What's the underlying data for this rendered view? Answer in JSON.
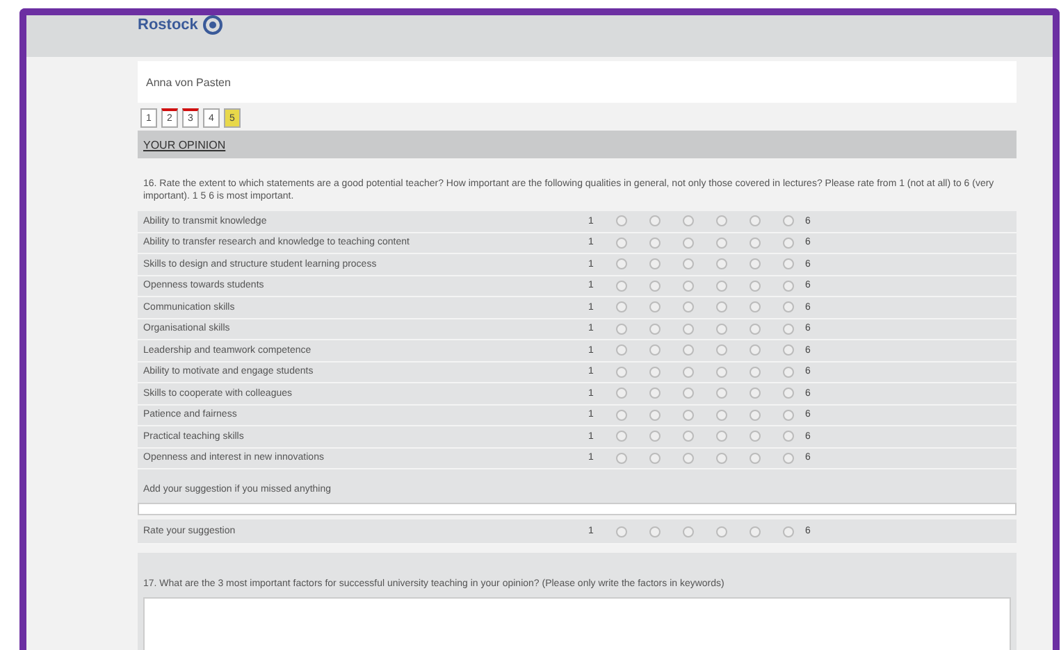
{
  "header": {
    "logo_text": "Rostock"
  },
  "respondent": {
    "name": "Anna von Pasten"
  },
  "pages": [
    {
      "label": "1",
      "selected": false,
      "completed": false
    },
    {
      "label": "2",
      "selected": false,
      "completed": true
    },
    {
      "label": "3",
      "selected": false,
      "completed": true
    },
    {
      "label": "4",
      "selected": false,
      "completed": false
    },
    {
      "label": "5",
      "selected": true,
      "completed": false
    }
  ],
  "section": {
    "title": "YOUR OPINION"
  },
  "question_16": {
    "text": "16. Rate the extent to which statements are a good potential teacher? How important are the following qualities in general, not only those covered in lectures? Please rate from 1 (not at all) to 6 (very important). 1 5 6 is most important.",
    "items": [
      {
        "label": "Ability to transmit knowledge",
        "scale_low": "1",
        "scale_high": "6",
        "choices": [
          false,
          false,
          false,
          false,
          false,
          false
        ]
      },
      {
        "label": "Ability to transfer research and knowledge to teaching content",
        "scale_low": "1",
        "scale_high": "6",
        "choices": [
          false,
          false,
          false,
          false,
          false,
          false
        ]
      },
      {
        "label": "Skills to design and structure student learning process",
        "scale_low": "1",
        "scale_high": "6",
        "choices": [
          false,
          false,
          false,
          false,
          false,
          false
        ]
      },
      {
        "label": "Openness towards students",
        "scale_low": "1",
        "scale_high": "6",
        "choices": [
          false,
          false,
          false,
          false,
          false,
          false
        ]
      },
      {
        "label": "Communication skills",
        "scale_low": "1",
        "scale_high": "6",
        "choices": [
          false,
          false,
          false,
          false,
          false,
          false
        ]
      },
      {
        "label": "Organisational skills",
        "scale_low": "1",
        "scale_high": "6",
        "choices": [
          false,
          false,
          false,
          false,
          false,
          false
        ]
      },
      {
        "label": "Leadership and teamwork competence",
        "scale_low": "1",
        "scale_high": "6",
        "choices": [
          false,
          false,
          false,
          false,
          false,
          false
        ]
      },
      {
        "label": "Ability to motivate and engage students",
        "scale_low": "1",
        "scale_high": "6",
        "choices": [
          false,
          false,
          false,
          false,
          false,
          false
        ]
      },
      {
        "label": "Skills to cooperate with colleagues",
        "scale_low": "1",
        "scale_high": "6",
        "choices": [
          false,
          false,
          false,
          false,
          false,
          false
        ]
      },
      {
        "label": "Patience and fairness",
        "scale_low": "1",
        "scale_high": "6",
        "choices": [
          false,
          false,
          false,
          false,
          false,
          false
        ]
      },
      {
        "label": "Practical teaching skills",
        "scale_low": "1",
        "scale_high": "6",
        "choices": [
          false,
          false,
          false,
          false,
          false,
          false
        ]
      },
      {
        "label": "Openness and interest in new innovations",
        "scale_low": "1",
        "scale_high": "6",
        "choices": [
          false,
          false,
          false,
          false,
          false,
          false
        ]
      }
    ],
    "suggestion_label": "Add your suggestion if you missed anything",
    "rate_suggestion": {
      "label": "Rate your suggestion",
      "scale_low": "1",
      "scale_high": "6",
      "choices": [
        false,
        false,
        false,
        false,
        false,
        false
      ]
    }
  },
  "question_17": {
    "text": "17. What are the 3 most important factors for successful university teaching in your opinion? (Please only write the factors in keywords)"
  }
}
